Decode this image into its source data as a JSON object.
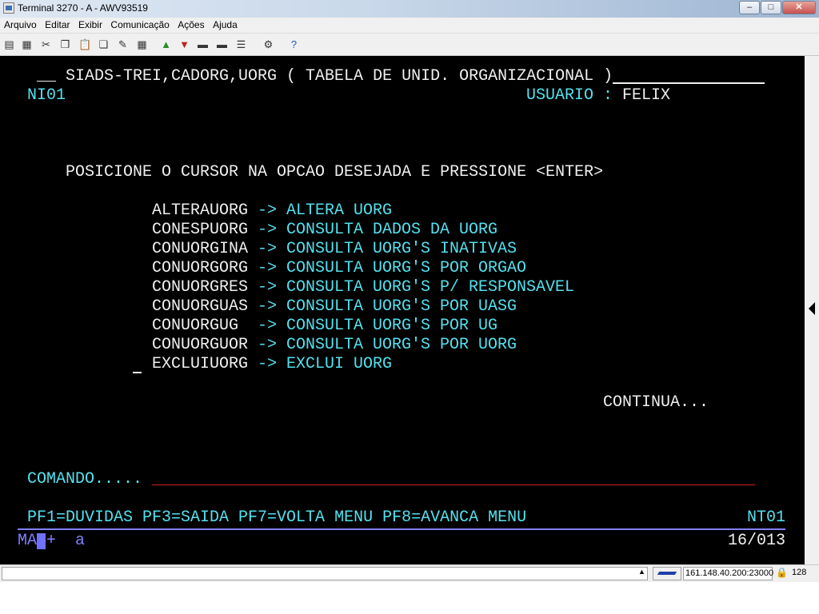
{
  "window": {
    "title": "Terminal 3270 - A - AWV93519",
    "buttons": {
      "minimize": "–",
      "maximize": "□",
      "close": "✕"
    }
  },
  "menu": [
    "Arquivo",
    "Editar",
    "Exibir",
    "Comunicação",
    "Ações",
    "Ajuda"
  ],
  "toolbar_icons": [
    "print-screen-icon",
    "print-icon",
    "cut-icon",
    "copy-icon",
    "paste-icon",
    "copy-append-icon",
    "edit-icon",
    "grid-icon",
    "send-file-icon",
    "receive-file-icon",
    "disconnect-icon",
    "connect-icon",
    "macro-icon",
    "settings-icon",
    "help-icon"
  ],
  "terminal": {
    "header_left": "__",
    "header_title": "SIADS-TREI,CADORG,UORG ( TABELA DE UNID. ORGANIZACIONAL )",
    "screen_id": "NI01",
    "user_label": "USUARIO :",
    "user_value": "FELIX",
    "instruction": "POSICIONE O CURSOR NA OPCAO DESEJADA E PRESSIONE <ENTER>",
    "options": [
      {
        "code": "ALTERAUORG",
        "arrow": "->",
        "desc": "ALTERA UORG"
      },
      {
        "code": "CONESPUORG",
        "arrow": "->",
        "desc": "CONSULTA DADOS DA UORG"
      },
      {
        "code": "CONUORGINA",
        "arrow": "->",
        "desc": "CONSULTA UORG'S INATIVAS"
      },
      {
        "code": "CONUORGORG",
        "arrow": "->",
        "desc": "CONSULTA UORG'S POR ORGAO"
      },
      {
        "code": "CONUORGRES",
        "arrow": "->",
        "desc": "CONSULTA UORG'S P/ RESPONSAVEL"
      },
      {
        "code": "CONUORGUAS",
        "arrow": "->",
        "desc": "CONSULTA UORG'S POR UASG"
      },
      {
        "code": "CONUORGUG",
        "arrow": "->",
        "desc": "CONSULTA UORG'S POR UG"
      },
      {
        "code": "CONUORGUOR",
        "arrow": "->",
        "desc": "CONSULTA UORG'S POR UORG"
      },
      {
        "code": "EXCLUIUORG",
        "arrow": "->",
        "desc": "EXCLUI UORG"
      }
    ],
    "continua": "CONTINUA...",
    "command_label": "COMANDO.....",
    "command_value": "",
    "pf_keys": "PF1=DUVIDAS PF3=SAIDA PF7=VOLTA MENU PF8=AVANCA MENU",
    "screen_code": "NT01",
    "oia_left": "MA",
    "oia_mid": "+",
    "oia_a": "a",
    "cursor_pos": "16/013"
  },
  "statusbar": {
    "host": "161.148.40.200:23000",
    "session": "128"
  },
  "colors": {
    "terminal_bg": "#000000",
    "text_white": "#f0f0f0",
    "text_cyan": "#54e1ef",
    "input_line": "#d42020"
  }
}
